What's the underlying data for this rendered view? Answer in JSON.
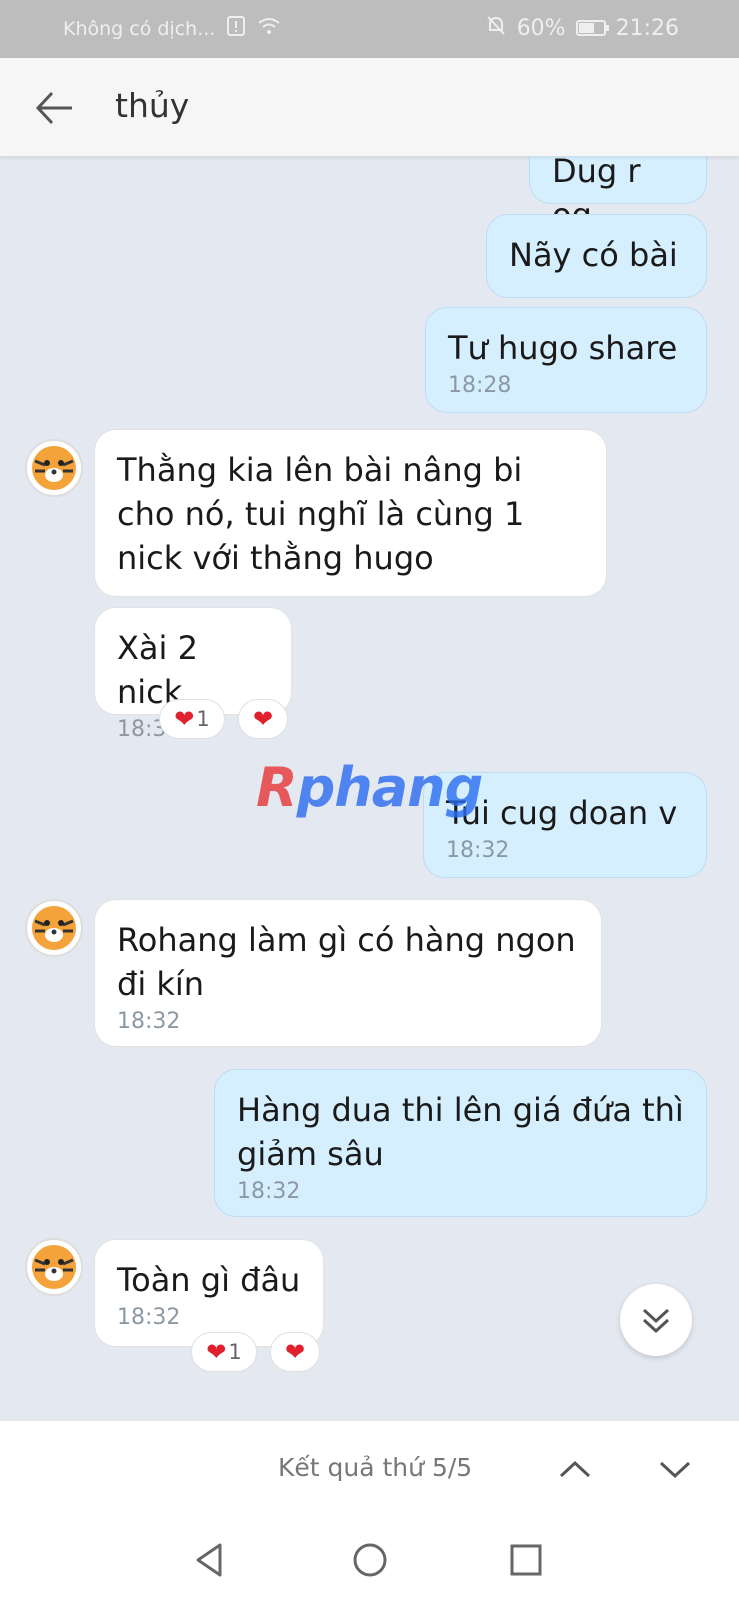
{
  "status_bar": {
    "carrier": "Không có dịch...",
    "battery": "60%",
    "time": "21:26",
    "icons": [
      "alert-icon",
      "wifi-icon",
      "bell-off-icon",
      "battery-icon"
    ]
  },
  "header": {
    "contact_name": "thủy"
  },
  "messages": [
    {
      "dir": "out",
      "text": "Dug r og",
      "time": ""
    },
    {
      "dir": "out",
      "text": "Nãy có bài",
      "time": ""
    },
    {
      "dir": "out",
      "text": "Tư hugo share",
      "time": "18:28"
    },
    {
      "dir": "in",
      "text": "Thằng kia lên bài nâng bi cho nó, tui nghĩ là cùng 1 nick với thằng hugo",
      "time": ""
    },
    {
      "dir": "in",
      "text": "Xài 2 nick",
      "time": "18:31",
      "reactions": [
        {
          "icon": "heart-icon",
          "count": "1"
        },
        {
          "icon": "heart-icon",
          "count": ""
        }
      ]
    },
    {
      "dir": "out",
      "text": "Tui cug doan v",
      "time": "18:32"
    },
    {
      "dir": "in",
      "text": "Rohang làm gì có hàng ngon đi kín",
      "time": "18:32"
    },
    {
      "dir": "out",
      "text": "Hàng dua thi lên giá đứa thì giảm sâu",
      "time": "18:32"
    },
    {
      "dir": "in",
      "text": "Toàn gì đâu",
      "time": "18:32",
      "reactions": [
        {
          "icon": "heart-icon",
          "count": "1"
        },
        {
          "icon": "heart-icon",
          "count": ""
        }
      ]
    }
  ],
  "watermark": {
    "r": "R",
    "rest": "phang"
  },
  "search": {
    "result_text": "Kết quả thứ 5/5"
  },
  "colors": {
    "outgoing_bubble": "#d6efff",
    "incoming_bubble": "#ffffff",
    "chat_background": "#e4e8f0",
    "heart": "#e0212d"
  }
}
